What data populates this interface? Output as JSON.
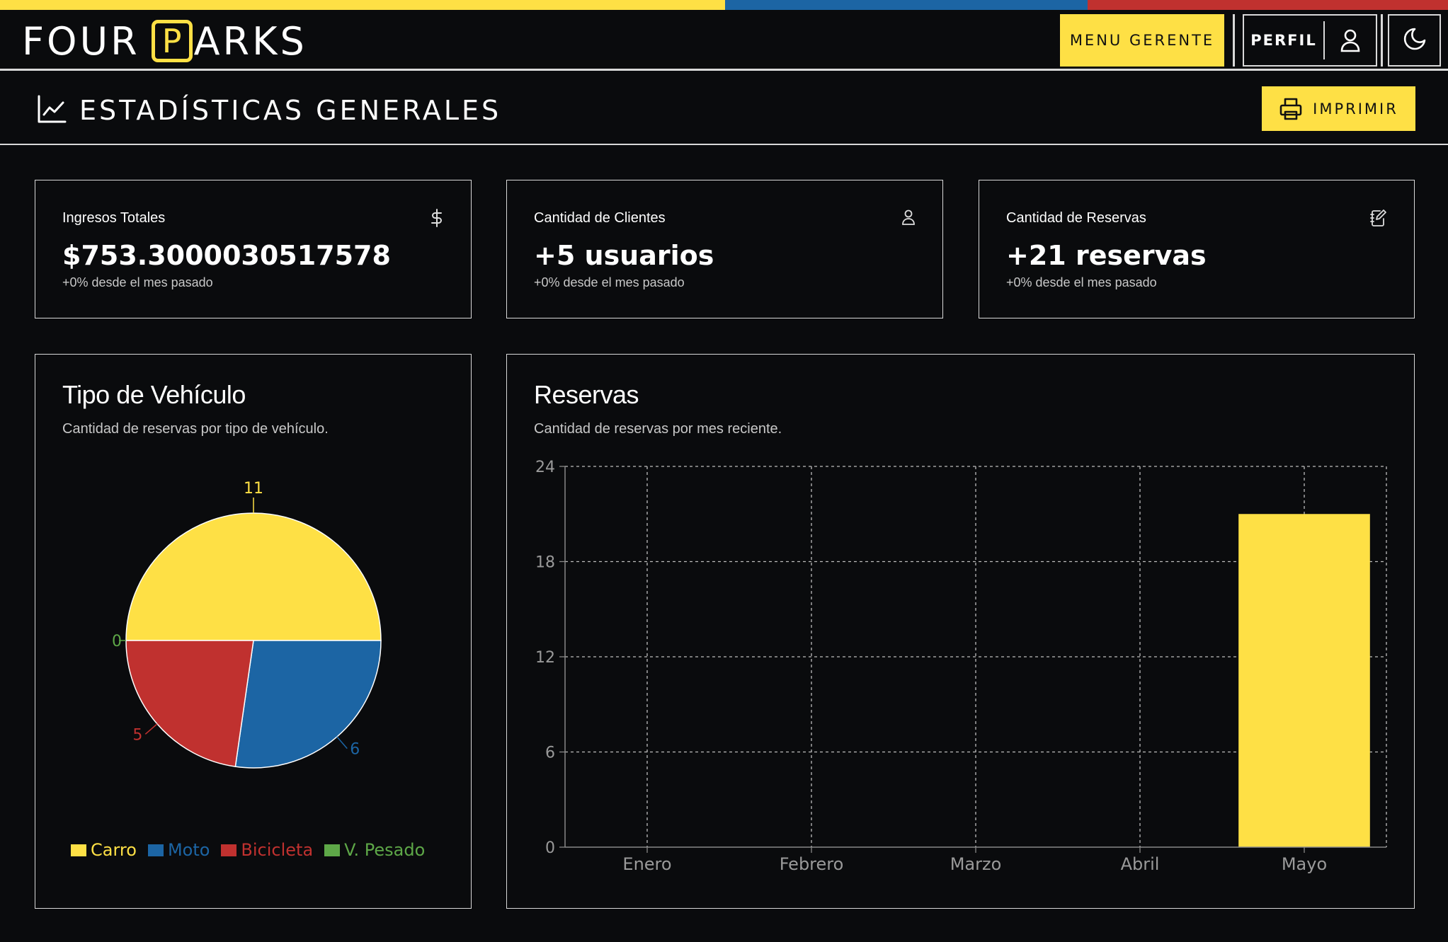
{
  "header": {
    "brand_left": "FOUR",
    "brand_p": "P",
    "brand_right": "ARKS",
    "menu_button": "MENU GERENTE",
    "profile_button": "PERFIL",
    "flag_colors": [
      "#fee045",
      "#1c65a4",
      "#c0312f"
    ]
  },
  "subheader": {
    "title": "ESTADÍSTICAS GENERALES",
    "print_button": "IMPRIMIR"
  },
  "stats": [
    {
      "title": "Ingresos Totales",
      "value": "$753.3000030517578",
      "sub": "+0% desde el mes pasado",
      "icon": "dollar-icon"
    },
    {
      "title": "Cantidad de Clientes",
      "value": "+5 usuarios",
      "sub": "+0% desde el mes pasado",
      "icon": "user-icon"
    },
    {
      "title": "Cantidad de Reservas",
      "value": "+21 reservas",
      "sub": "+0% desde el mes pasado",
      "icon": "notebook-pen-icon"
    }
  ],
  "vehicle_card": {
    "title": "Tipo de Vehículo",
    "description": "Cantidad de reservas por tipo de vehículo."
  },
  "reservas_card": {
    "title": "Reservas",
    "description": "Cantidad de reservas por mes reciente."
  },
  "chart_data": [
    {
      "type": "pie",
      "title": "Tipo de Vehículo",
      "categories": [
        "Carro",
        "Moto",
        "Bicicleta",
        "V. Pesado"
      ],
      "values": [
        11,
        6,
        5,
        0
      ],
      "colors": [
        "#fee045",
        "#1c65a4",
        "#c0312f",
        "#5ea848"
      ],
      "legend": "bottom"
    },
    {
      "type": "bar",
      "title": "Reservas",
      "categories": [
        "Enero",
        "Febrero",
        "Marzo",
        "Abril",
        "Mayo"
      ],
      "values": [
        0,
        0,
        0,
        0,
        21
      ],
      "ylim": [
        0,
        24
      ],
      "yticks": [
        0,
        6,
        12,
        18,
        24
      ],
      "grid": true,
      "bar_color": "#fee045"
    }
  ]
}
